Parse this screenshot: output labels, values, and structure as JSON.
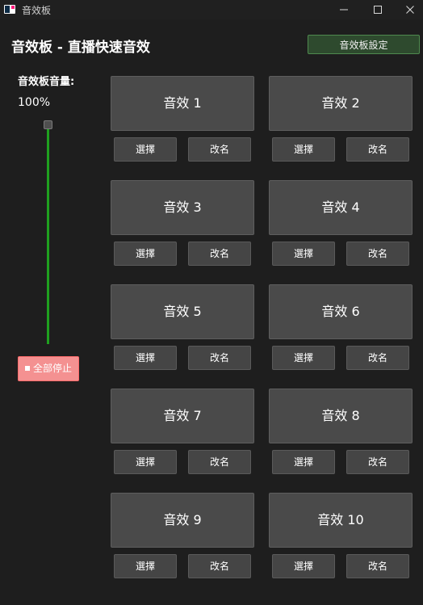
{
  "window": {
    "title": "音效板",
    "minimize_glyph": "─",
    "close_glyph": "✕"
  },
  "header": {
    "title": "音效板 - 直播快速音效",
    "settings_label": "音效板設定"
  },
  "volume": {
    "label": "音效板音量:",
    "value_text": "100%",
    "level_percent": 100
  },
  "stop_all": {
    "label": "全部停止"
  },
  "sounds": [
    {
      "label": "音效 1",
      "select_label": "選擇",
      "rename_label": "改名"
    },
    {
      "label": "音效 2",
      "select_label": "選擇",
      "rename_label": "改名"
    },
    {
      "label": "音效 3",
      "select_label": "選擇",
      "rename_label": "改名"
    },
    {
      "label": "音效 4",
      "select_label": "選擇",
      "rename_label": "改名"
    },
    {
      "label": "音效 5",
      "select_label": "選擇",
      "rename_label": "改名"
    },
    {
      "label": "音效 6",
      "select_label": "選擇",
      "rename_label": "改名"
    },
    {
      "label": "音效 7",
      "select_label": "選擇",
      "rename_label": "改名"
    },
    {
      "label": "音效 8",
      "select_label": "選擇",
      "rename_label": "改名"
    },
    {
      "label": "音效 9",
      "select_label": "選擇",
      "rename_label": "改名"
    },
    {
      "label": "音效 10",
      "select_label": "選擇",
      "rename_label": "改名"
    }
  ],
  "colors": {
    "background": "#1e1e1e",
    "accent_green": "#1fa01f",
    "stop_red": "#f49191",
    "button_gray": "#4a4a4a"
  }
}
